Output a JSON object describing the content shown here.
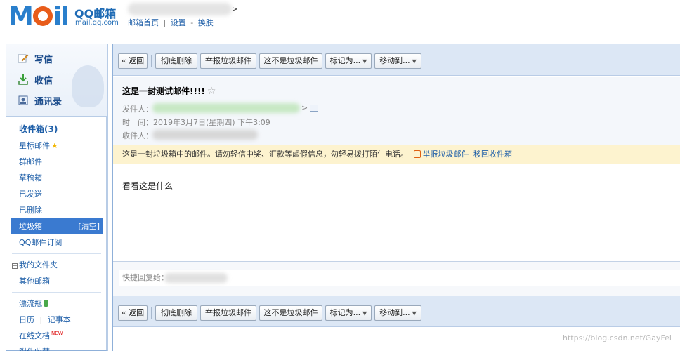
{
  "header": {
    "logo_text": "Mail",
    "brand": "QQ邮箱",
    "brand_url": "mail.qq.com",
    "user_arrow": ">",
    "links": [
      "邮箱首页",
      "设置",
      "换肤"
    ],
    "link_sep": "|",
    "link_dash": "-"
  },
  "quick": {
    "compose": "写信",
    "inbox": "收信",
    "contacts": "通讯录"
  },
  "nav": {
    "inbox": "收件箱(3)",
    "starred": "星标邮件",
    "group": "群邮件",
    "drafts": "草稿箱",
    "sent": "已发送",
    "deleted": "已删除",
    "spam": "垃圾箱",
    "spam_clear": "[清空]",
    "subscribe": "QQ邮件订阅",
    "my_folders": "我的文件夹",
    "other_mailbox": "其他邮箱",
    "drift_bottle": "漂流瓶",
    "calendar": "日历",
    "notebook": "记事本",
    "online_docs": "在线文档",
    "new_badge": "NEW",
    "attachments": "附件收藏"
  },
  "toolbar": {
    "back": "« 返回",
    "delete_forever": "彻底删除",
    "report_spam": "举报垃圾邮件",
    "not_spam": "这不是垃圾邮件",
    "mark_as": "标记为...",
    "move_to": "移动到..."
  },
  "mail": {
    "subject": "这是一封测试邮件!!!!",
    "sender_label": "发件人：",
    "time_label": "时　间：",
    "time_value": "2019年3月7日(星期四) 下午3:09",
    "recipient_label": "收件人：",
    "warning": "这是一封垃圾箱中的邮件。请勿轻信中奖、汇款等虚假信息，勿轻易拨打陌生电话。",
    "warning_report": "举报垃圾邮件",
    "warning_move": "移回收件箱",
    "body": "看看这是什么",
    "quick_reply": "快捷回复给："
  },
  "watermark": "https://blog.csdn.net/GayFei",
  "colors": {
    "brand_blue": "#1f6bb5",
    "nav_active": "#3a7ad0",
    "toolbar_bg": "#dce7f5",
    "warn_bg": "#fdf3cf"
  }
}
